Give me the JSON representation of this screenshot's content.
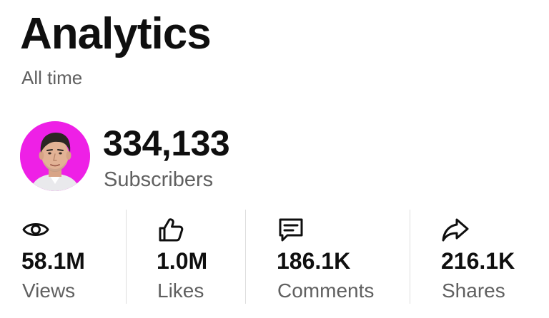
{
  "header": {
    "title": "Analytics",
    "period": "All time"
  },
  "channel": {
    "avatar_color": "#ee20e6",
    "subscriber_count": "334,133",
    "subscriber_label": "Subscribers"
  },
  "stats": [
    {
      "icon": "eye-icon",
      "value": "58.1M",
      "label": "Views"
    },
    {
      "icon": "thumbs-up-icon",
      "value": "1.0M",
      "label": "Likes"
    },
    {
      "icon": "comment-icon",
      "value": "186.1K",
      "label": "Comments"
    },
    {
      "icon": "share-icon",
      "value": "216.1K",
      "label": "Shares"
    }
  ]
}
